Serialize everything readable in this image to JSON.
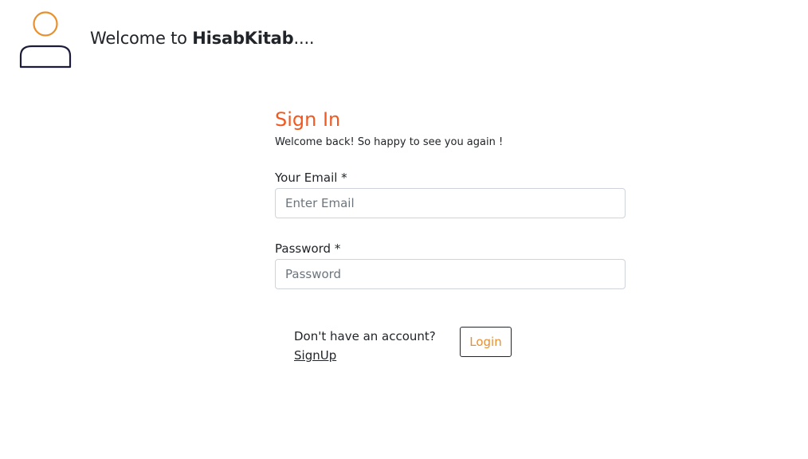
{
  "header": {
    "welcome_prefix": "Welcome to ",
    "brand": "HisabKitab",
    "welcome_suffix": "....",
    "avatar_icon": "user-icon"
  },
  "signin": {
    "title": "Sign In",
    "subtitle": "Welcome back! So happy to see you again !",
    "email_label": "Your Email *",
    "email_placeholder": "Enter Email",
    "email_value": "",
    "password_label": "Password *",
    "password_placeholder": "Password",
    "password_value": "",
    "account_text": "Don't have an account?",
    "signup_label": "SignUp",
    "login_label": "Login"
  },
  "colors": {
    "title": "#f05a22",
    "login_text": "#e8902e",
    "avatar_head": "#e8902e",
    "avatar_body": "#1c1c3a",
    "input_border": "#ced4da"
  }
}
